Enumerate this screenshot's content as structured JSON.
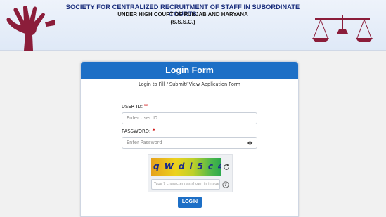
{
  "header": {
    "line1": "SOCIETY FOR CENTRALIZED RECRUITMENT OF STAFF IN SUBORDINATE COURTS",
    "line2": "UNDER HIGH COURT OF PUNJAB AND HARYANA",
    "line3": "(S.S.S.C.)"
  },
  "form": {
    "title": "Login Form",
    "subtitle": "Login to Fill / Submit/ View Application Form",
    "user_id_label": "USER ID:",
    "user_id_placeholder": "Enter User ID",
    "password_label": "PASSWORD:",
    "password_placeholder": "Enter Password",
    "required_mark": "*",
    "captcha_text": "qWdi5c4",
    "captcha_placeholder": "Type 7 characters as shown in image",
    "login_label": "LOGIN"
  },
  "colors": {
    "primary": "#1d6fc6",
    "title_blue": "#1b2f7d",
    "logo_maroon": "#8b1d3a",
    "required_red": "#d21b1b"
  },
  "icons": [
    "open-hand-emblem-icon",
    "scales-of-justice-icon",
    "eye-icon",
    "refresh-icon",
    "help-icon"
  ]
}
